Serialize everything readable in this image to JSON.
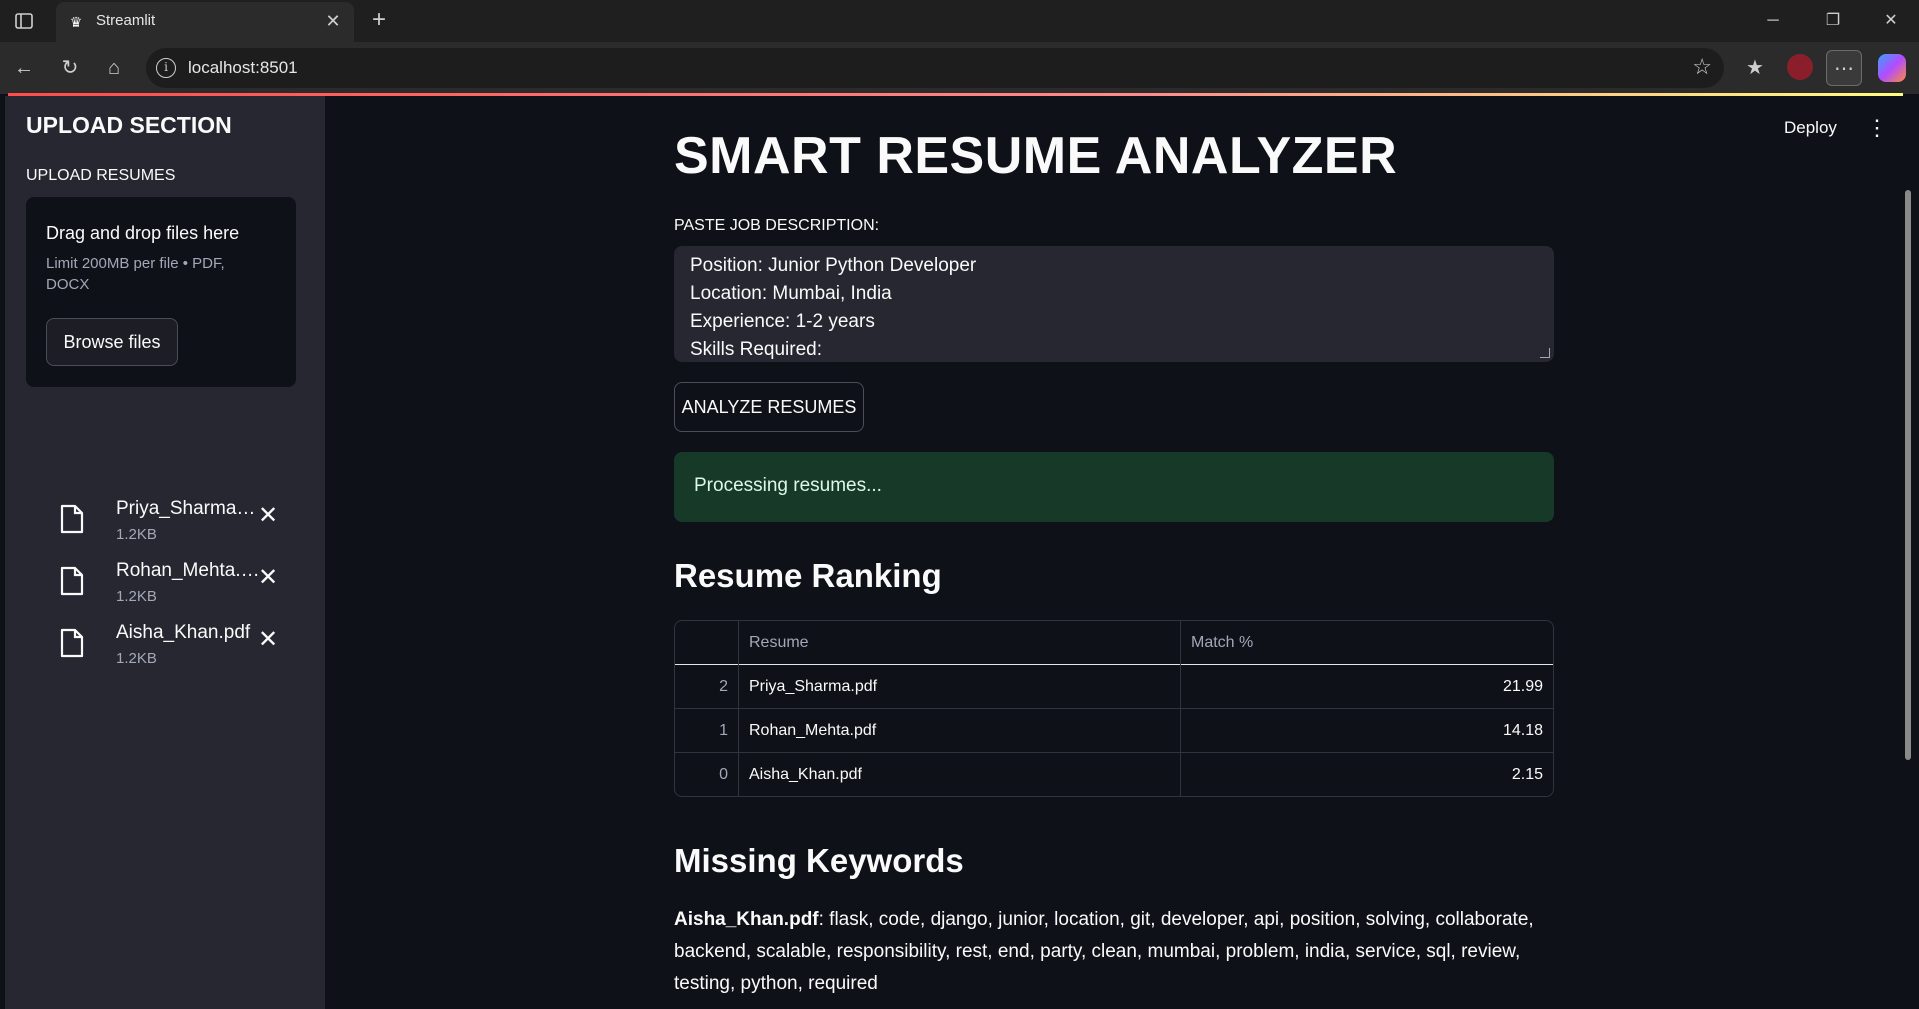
{
  "browser": {
    "tab_title": "Streamlit",
    "url": "localhost:8501"
  },
  "sidebar": {
    "header": "UPLOAD SECTION",
    "upload_label": "UPLOAD RESUMES",
    "dropzone": {
      "title": "Drag and drop files here",
      "subtitle": "Limit 200MB per file • PDF, DOCX",
      "browse_label": "Browse files"
    },
    "files": [
      {
        "name": "Priya_Sharma.pdf",
        "size": "1.2KB"
      },
      {
        "name": "Rohan_Mehta.pdf",
        "size": "1.2KB"
      },
      {
        "name": "Aisha_Khan.pdf",
        "size": "1.2KB"
      }
    ]
  },
  "header": {
    "deploy_label": "Deploy"
  },
  "main": {
    "title": "SMART RESUME ANALYZER",
    "jd_label": "PASTE JOB DESCRIPTION:",
    "jd_lines": [
      "Position: Junior Python Developer",
      "Location: Mumbai, India",
      "Experience: 1-2 years",
      "Skills Required:"
    ],
    "analyze_label": "ANALYZE RESUMES",
    "status": "Processing resumes...",
    "ranking_heading": "Resume Ranking",
    "table": {
      "columns": [
        "",
        "Resume",
        "Match %"
      ],
      "rows": [
        {
          "index": "2",
          "resume": "Priya_Sharma.pdf",
          "match": "21.99"
        },
        {
          "index": "1",
          "resume": "Rohan_Mehta.pdf",
          "match": "14.18"
        },
        {
          "index": "0",
          "resume": "Aisha_Khan.pdf",
          "match": "2.15"
        }
      ]
    },
    "missing_heading": "Missing Keywords",
    "missing": {
      "file": "Aisha_Khan.pdf",
      "keywords": ": flask, code, django, junior, location, git, developer, api, position, solving, collaborate, backend, scalable, responsibility, rest, end, party, clean, mumbai, problem, india, service, sql, review, testing, python, required"
    }
  },
  "colors": {
    "app_bg": "#0e1117",
    "sidebar_bg": "#262730",
    "success_bg": "#173928",
    "accent": "#ff4b4b"
  }
}
